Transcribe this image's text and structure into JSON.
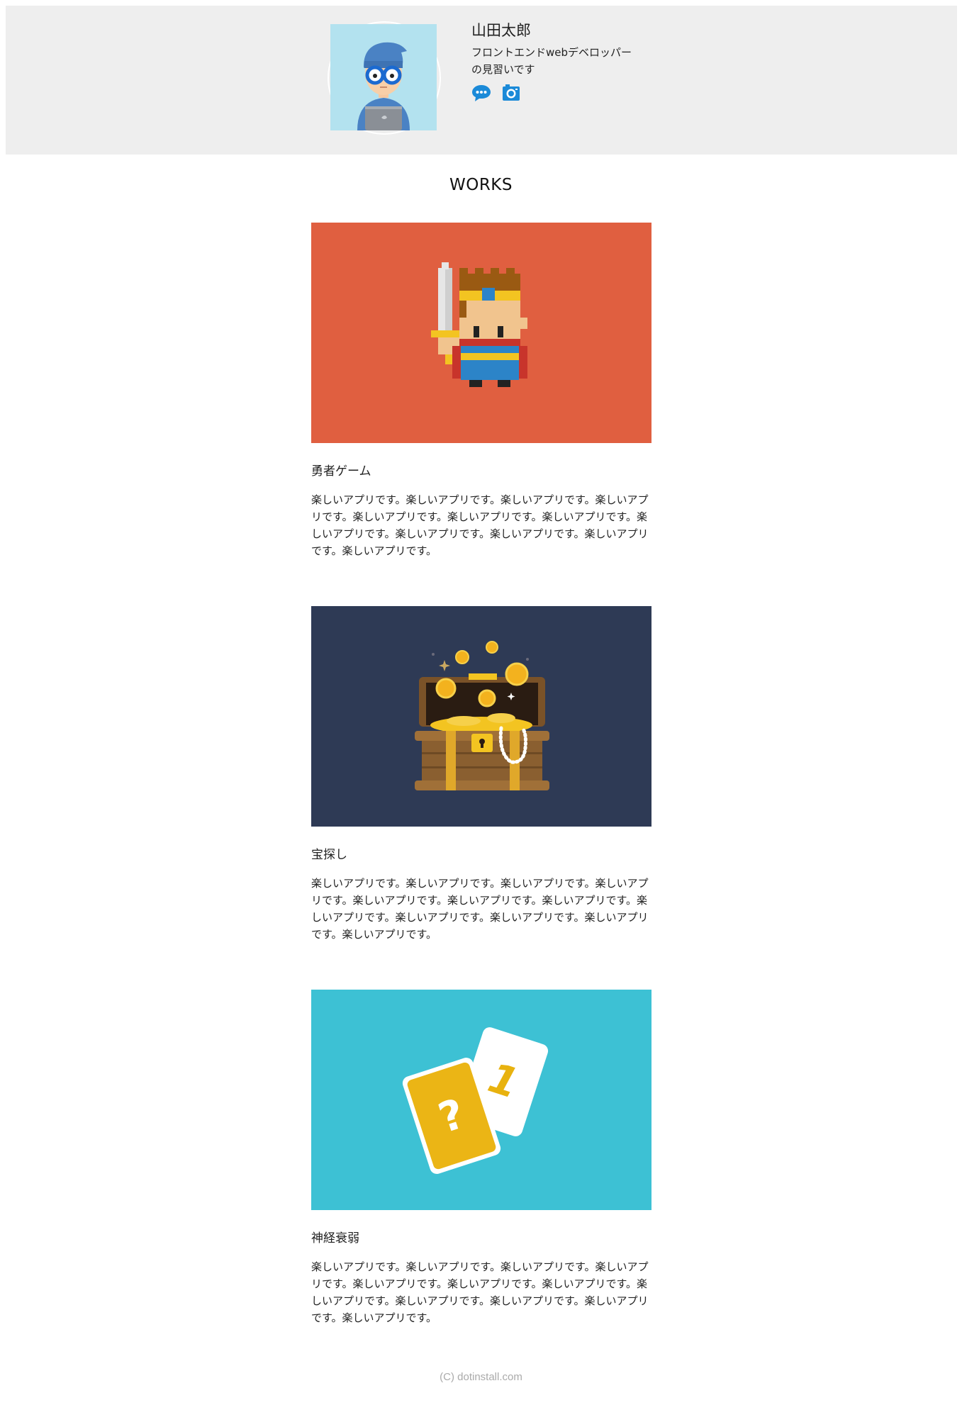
{
  "profile": {
    "name": "山田太郎",
    "description": "フロントエンドwebデベロッパーの見習いです",
    "icons": [
      "chat-icon",
      "camera-icon"
    ],
    "icon_color": "#1b8ad8"
  },
  "works": {
    "heading": "WORKS",
    "items": [
      {
        "title": "勇者ゲーム",
        "description": "楽しいアプリです。楽しいアプリです。楽しいアプリです。楽しいアプリです。楽しいアプリです。楽しいアプリです。楽しいアプリです。楽しいアプリです。楽しいアプリです。楽しいアプリです。楽しいアプリです。楽しいアプリです。",
        "image_icon": "hero-pixel-icon",
        "bg_color": "#e05f40"
      },
      {
        "title": "宝探し",
        "description": "楽しいアプリです。楽しいアプリです。楽しいアプリです。楽しいアプリです。楽しいアプリです。楽しいアプリです。楽しいアプリです。楽しいアプリです。楽しいアプリです。楽しいアプリです。楽しいアプリです。楽しいアプリです。",
        "image_icon": "treasure-chest-icon",
        "bg_color": "#2e3a55"
      },
      {
        "title": "神経衰弱",
        "description": "楽しいアプリです。楽しいアプリです。楽しいアプリです。楽しいアプリです。楽しいアプリです。楽しいアプリです。楽しいアプリです。楽しいアプリです。楽しいアプリです。楽しいアプリです。楽しいアプリです。楽しいアプリです。",
        "image_icon": "cards-icon",
        "bg_color": "#3dc1d4"
      }
    ]
  },
  "footer": {
    "copyright": "(C) dotinstall.com"
  }
}
